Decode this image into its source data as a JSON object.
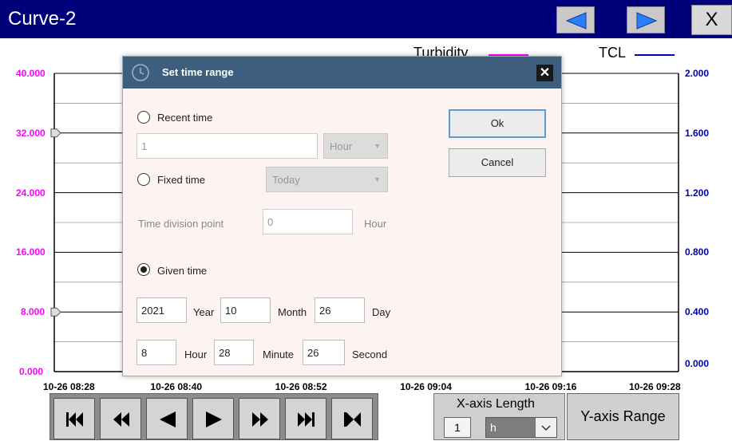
{
  "window": {
    "title": "Curve-2",
    "close_label": "X"
  },
  "legend": {
    "series1": "Turbidity",
    "series2": "TCL"
  },
  "colors": {
    "titlebar": "#00007a",
    "left_axis": "#ff00ff",
    "right_axis": "#0000aa",
    "dialog_header": "#3e5e7f"
  },
  "chart_data": {
    "type": "line",
    "series": [
      {
        "name": "Turbidity",
        "values": []
      },
      {
        "name": "TCL",
        "values": []
      }
    ],
    "y_left_ticks": [
      "40.000",
      "32.000",
      "24.000",
      "16.000",
      "8.000",
      "0.000"
    ],
    "y_right_ticks": [
      "2.000",
      "1.600",
      "1.200",
      "0.800",
      "0.400",
      "0.000"
    ],
    "x_ticks": [
      "10-26 08:28",
      "10-26 08:40",
      "10-26 08:52",
      "10-26 09:04",
      "10-26 09:16",
      "10-26 09:28"
    ],
    "ylim_left": [
      0,
      40
    ],
    "ylim_right": [
      0,
      2
    ],
    "grid": true
  },
  "dialog": {
    "title": "Set time range",
    "recent_time_label": "Recent time",
    "recent_value": "1",
    "recent_unit": "Hour",
    "fixed_time_label": "Fixed time",
    "fixed_value": "Today",
    "time_division_label": "Time division point",
    "time_division_value": "0",
    "time_division_unit": "Hour",
    "given_time_label": "Given time",
    "year": "2021",
    "year_label": "Year",
    "month": "10",
    "month_label": "Month",
    "day": "26",
    "day_label": "Day",
    "hour": "8",
    "hour_label": "Hour",
    "minute": "28",
    "minute_label": "Minute",
    "second": "26",
    "second_label": "Second",
    "ok_label": "Ok",
    "cancel_label": "Cancel",
    "selected_mode": "Given time"
  },
  "bottom": {
    "xaxis_label": "X-axis Length",
    "xaxis_value": "1",
    "xaxis_unit": "h",
    "yrange_label": "Y-axis Range",
    "playback_icons": [
      "skip-to-start-icon",
      "rewind-icon",
      "step-back-icon",
      "play-icon",
      "fast-forward-icon",
      "skip-to-end-icon",
      "skip-to-newest-icon"
    ]
  }
}
